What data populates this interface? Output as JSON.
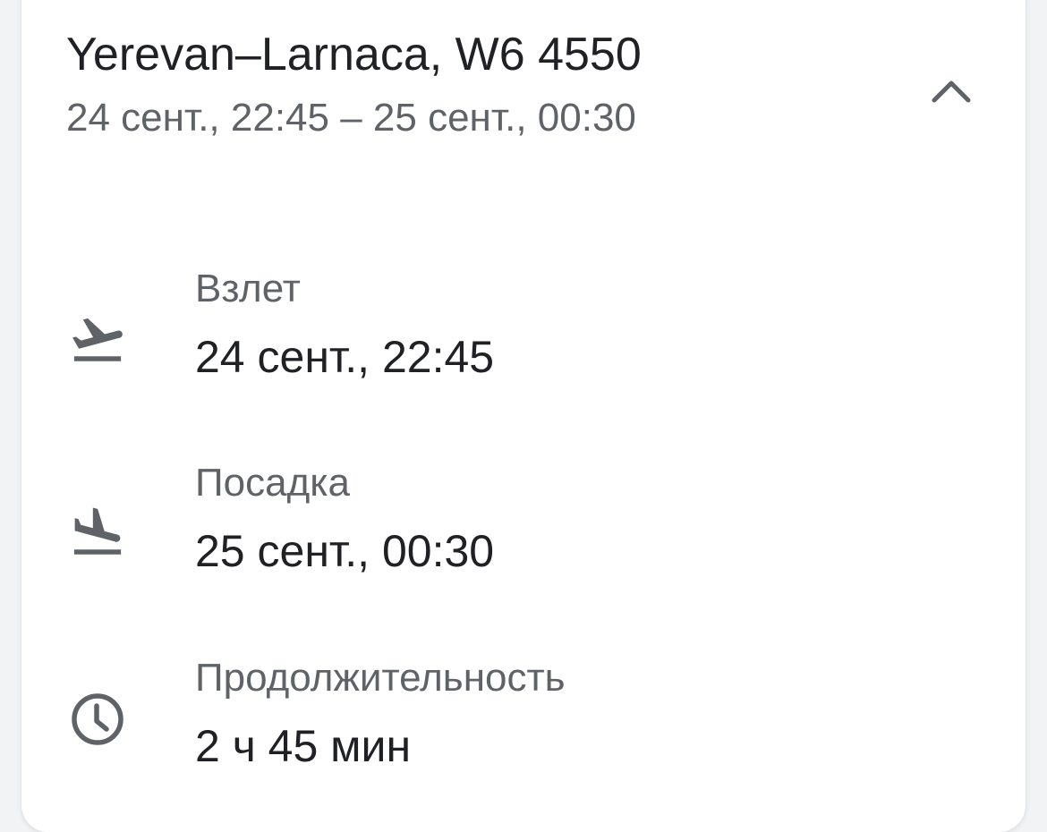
{
  "flight": {
    "title": "Yerevan–Larnaca, W6 4550",
    "subtitle": "24 сент., 22:45 – 25 сент., 00:30"
  },
  "details": {
    "takeoff": {
      "icon": "flight-takeoff-icon",
      "label": "Взлет",
      "value": "24 сент., 22:45"
    },
    "landing": {
      "icon": "flight-land-icon",
      "label": "Посадка",
      "value": "25 сент., 00:30"
    },
    "duration": {
      "icon": "clock-icon",
      "label": "Продолжительность",
      "value": "2 ч 45 мин"
    }
  },
  "collapse_icon": "chevron-up-icon",
  "colors": {
    "primary_text": "#202124",
    "secondary_text": "#5f6368",
    "card_background": "#ffffff"
  }
}
